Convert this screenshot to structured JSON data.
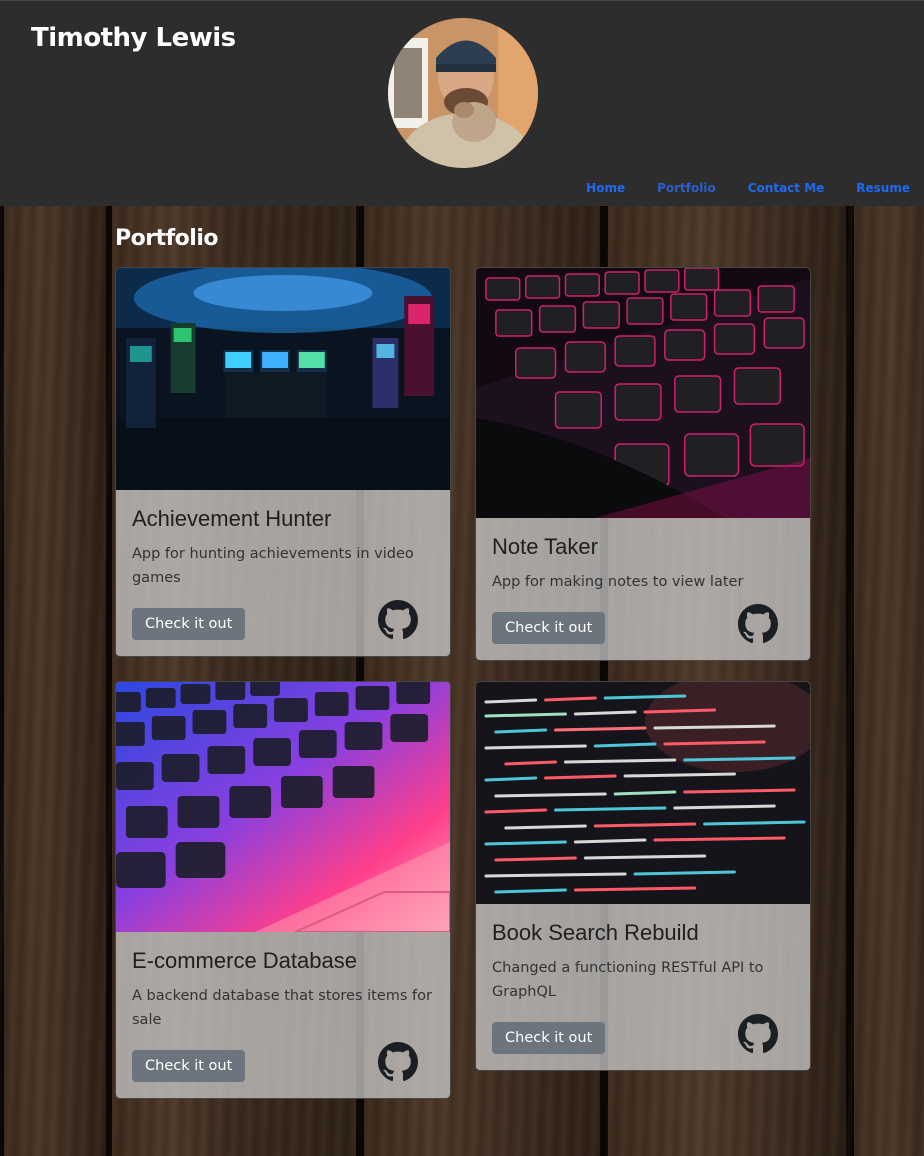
{
  "header": {
    "brand": "Timothy Lewis",
    "avatar_alt": "profile photo",
    "nav": [
      {
        "label": "Home"
      },
      {
        "label": "Portfolio"
      },
      {
        "label": "Contact Me"
      },
      {
        "label": "Resume"
      }
    ]
  },
  "main": {
    "section_title": "Portfolio",
    "projects": [
      {
        "title": "Achievement Hunter",
        "description": "App for hunting achievements in video games",
        "button_label": "Check it out",
        "icon": "github-icon"
      },
      {
        "title": "Note Taker",
        "description": "App for making notes to view later",
        "button_label": "Check it out",
        "icon": "github-icon"
      },
      {
        "title": "E-commerce Database",
        "description": "A backend database that stores items for sale",
        "button_label": "Check it out",
        "icon": "github-icon"
      },
      {
        "title": "Book Search Rebuild",
        "description": "Changed a functioning RESTful API to GraphQL",
        "button_label": "Check it out",
        "icon": "github-icon"
      }
    ]
  },
  "colors": {
    "header_bg": "#2d2d2d",
    "nav_link": "#1f6bf0",
    "button_bg": "#6c757d",
    "card_bg": "rgba(210,210,210,0.72)"
  }
}
